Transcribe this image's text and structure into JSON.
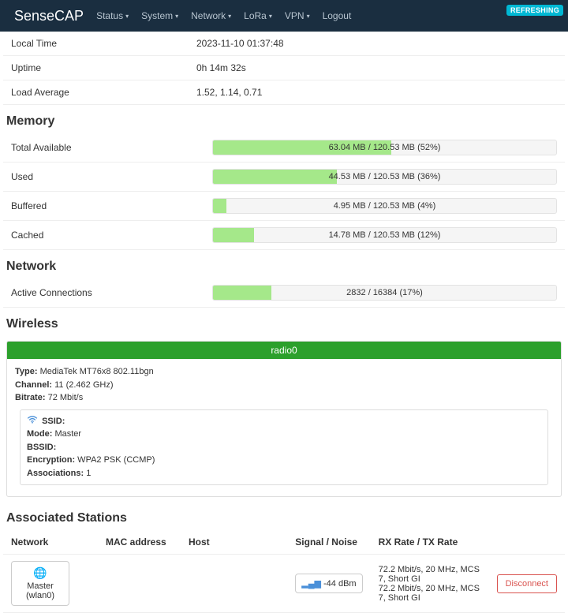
{
  "brand": "SenseCAP",
  "nav": [
    "Status",
    "System",
    "Network",
    "LoRa",
    "VPN"
  ],
  "logout": "Logout",
  "refresh": "REFRESHING",
  "status_rows": [
    {
      "label": "Local Time",
      "value": "2023-11-10 01:37:48"
    },
    {
      "label": "Uptime",
      "value": "0h 14m 32s"
    },
    {
      "label": "Load Average",
      "value": "1.52, 1.14, 0.71"
    }
  ],
  "memory": {
    "heading": "Memory",
    "rows": [
      {
        "label": "Total Available",
        "text": "63.04 MB / 120.53 MB (52%)",
        "pct": 52
      },
      {
        "label": "Used",
        "text": "44.53 MB / 120.53 MB (36%)",
        "pct": 36
      },
      {
        "label": "Buffered",
        "text": "4.95 MB / 120.53 MB (4%)",
        "pct": 4
      },
      {
        "label": "Cached",
        "text": "14.78 MB / 120.53 MB (12%)",
        "pct": 12
      }
    ]
  },
  "network": {
    "heading": "Network",
    "rows": [
      {
        "label": "Active Connections",
        "text": "2832 / 16384 (17%)",
        "pct": 17
      }
    ]
  },
  "wireless": {
    "heading": "Wireless",
    "radio": "radio0",
    "type_label": "Type:",
    "type_val": " MediaTek MT76x8 802.11bgn",
    "channel_label": "Channel:",
    "channel_val": " 11 (2.462 GHz)",
    "bitrate_label": "Bitrate:",
    "bitrate_val": " 72 Mbit/s",
    "ssid_label": "SSID:",
    "ssid_val": "",
    "mode_label": "Mode:",
    "mode_val": " Master",
    "bssid_label": "BSSID:",
    "bssid_val": "",
    "enc_label": "Encryption:",
    "enc_val": " WPA2 PSK (CCMP)",
    "assoc_label": "Associations:",
    "assoc_val": " 1"
  },
  "assoc": {
    "heading": "Associated Stations",
    "cols": [
      "Network",
      "MAC address",
      "Host",
      "Signal / Noise",
      "RX Rate / TX Rate"
    ],
    "row": {
      "net_name": "Master",
      "net_if": "(wlan0)",
      "mac": "",
      "host": "",
      "signal": "-44 dBm",
      "rx": "72.2 Mbit/s, 20 MHz, MCS 7, Short GI",
      "tx": "72.2 Mbit/s, 20 MHz, MCS 7, Short GI",
      "disconnect": "Disconnect"
    }
  }
}
